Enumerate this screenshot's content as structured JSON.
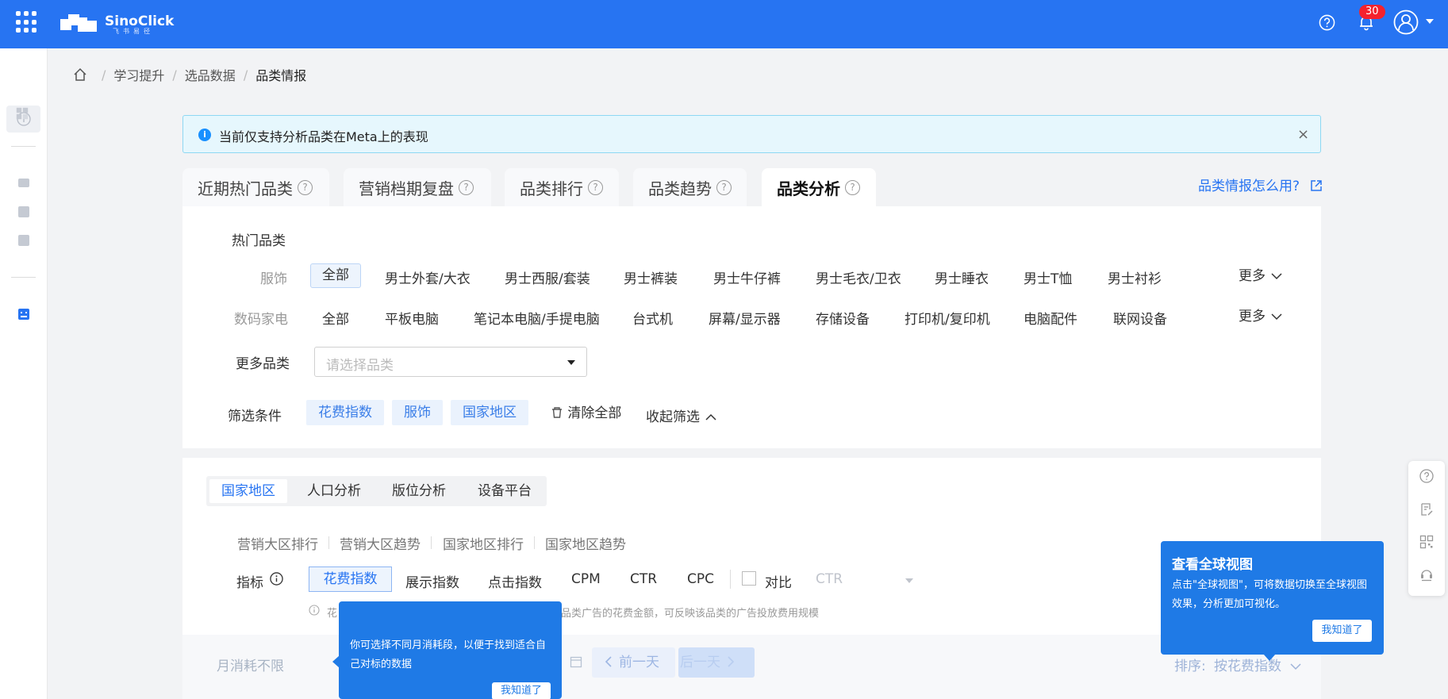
{
  "header": {
    "logo_text": "SinoClick",
    "logo_sub": "飞书易径",
    "notifications_count": "30"
  },
  "breadcrumb": {
    "items": [
      "学习提升",
      "选品数据",
      "品类情报"
    ],
    "separator": "/"
  },
  "alert": {
    "icon": "i",
    "text": "当前仅支持分析品类在Meta上的表现",
    "close": "×"
  },
  "tabs": [
    {
      "label": "近期热门品类",
      "help": "?"
    },
    {
      "label": "营销档期复盘",
      "help": "?"
    },
    {
      "label": "品类排行",
      "help": "?"
    },
    {
      "label": "品类趋势",
      "help": "?"
    },
    {
      "label": "品类分析",
      "help": "?",
      "active": true
    }
  ],
  "howto_link": "品类情报怎么用?",
  "hot_categories": {
    "title": "热门品类",
    "rows": [
      {
        "label": "服饰",
        "items": [
          "全部",
          "男士外套/大衣",
          "男士西服/套装",
          "男士裤装",
          "男士牛仔裤",
          "男士毛衣/卫衣",
          "男士睡衣",
          "男士T恤",
          "男士衬衫"
        ],
        "more": "更多"
      },
      {
        "label": "数码家电",
        "items": [
          "全部",
          "平板电脑",
          "笔记本电脑/手提电脑",
          "台式机",
          "屏幕/显示器",
          "存储设备",
          "打印机/复印机",
          "电脑配件",
          "联网设备"
        ],
        "more": "更多"
      }
    ],
    "more_categories_label": "更多品类",
    "select_placeholder": "请选择品类"
  },
  "filters": {
    "label": "筛选条件",
    "tags": [
      "花费指数",
      "服饰",
      "国家地区"
    ],
    "clear_all": "清除全部",
    "collapse": "收起筛选"
  },
  "analysis": {
    "segments": [
      "国家地区",
      "人口分析",
      "版位分析",
      "设备平台"
    ],
    "subtabs": [
      "营销大区排行",
      "营销大区趋势",
      "国家地区排行",
      "国家地区趋势"
    ],
    "metric_label": "指标",
    "metrics": [
      "花费指数",
      "展示指数",
      "点击指数",
      "CPM",
      "CTR",
      "CPC"
    ],
    "compare_label": "对比",
    "compare_value": "CTR",
    "hint_prefix": "花",
    "hint_text": "品类广告的花费金额，可反映该品类的广告投放费用规模"
  },
  "toolbar": {
    "monthly_spend": "月消耗不限",
    "prev_day": "前一天",
    "next_day": "后一天",
    "sort_label": "排序:",
    "sort_value": "按花费指数"
  },
  "tooltips": {
    "spend_tip": {
      "text": "你可选择不同月消耗段，以便于找到适合自己对标的数据",
      "button": "我知道了"
    },
    "global_view_tip": {
      "title": "查看全球视图",
      "text": "点击\"全球视图\"，可将数据切换至全球视图效果，分析更加可视化。",
      "button": "我知道了"
    }
  },
  "colors": {
    "brand": "#2774f2",
    "tooltip": "#1f7ae6",
    "badge": "#f5222d"
  }
}
